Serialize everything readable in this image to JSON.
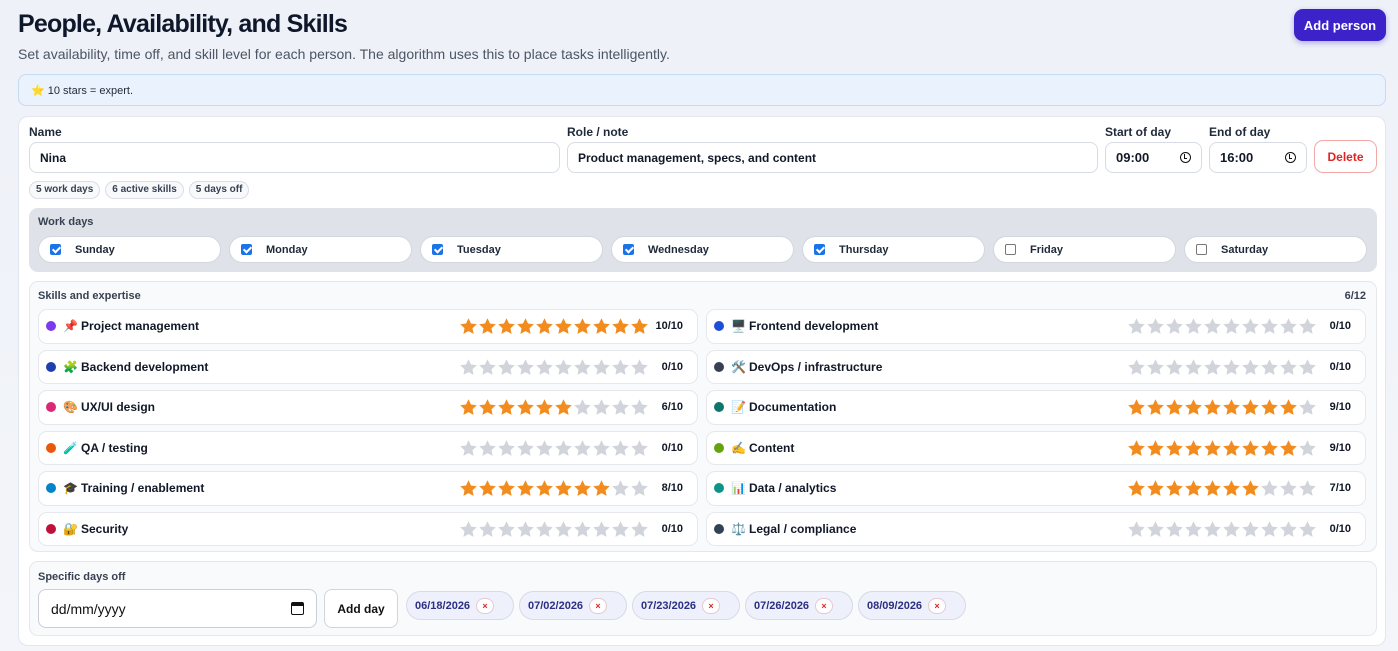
{
  "header": {
    "title": "People, Availability, and Skills",
    "subtitle": "Set availability, time off, and skill level for each person. The algorithm uses this to place tasks intelligently.",
    "add_person_label": "Add person"
  },
  "banner": {
    "text": "⭐ 10 stars = expert."
  },
  "person": {
    "name_label": "Name",
    "name_value": "Nina",
    "role_label": "Role / note",
    "role_value": "Product management, specs, and content",
    "start_label": "Start of day",
    "start_value": "09:00",
    "end_label": "End of day",
    "end_value": "16:00",
    "delete_label": "Delete",
    "chips": [
      "5 work days",
      "6 active skills",
      "5 days off"
    ]
  },
  "workdays": {
    "label": "Work days",
    "days": [
      {
        "label": "Sunday",
        "checked": true
      },
      {
        "label": "Monday",
        "checked": true
      },
      {
        "label": "Tuesday",
        "checked": true
      },
      {
        "label": "Wednesday",
        "checked": true
      },
      {
        "label": "Thursday",
        "checked": true
      },
      {
        "label": "Friday",
        "checked": false
      },
      {
        "label": "Saturday",
        "checked": false
      }
    ]
  },
  "skills": {
    "label": "Skills and expertise",
    "count": "6/12",
    "max": 10,
    "items": [
      {
        "name": "Project management",
        "emoji": "📌",
        "color": "#7c3aed",
        "rating": 10,
        "score": "10/10"
      },
      {
        "name": "Frontend development",
        "emoji": "🖥️",
        "color": "#1d4ed8",
        "rating": 0,
        "score": "0/10"
      },
      {
        "name": "Backend development",
        "emoji": "🧩",
        "color": "#1e40af",
        "rating": 0,
        "score": "0/10"
      },
      {
        "name": "DevOps / infrastructure",
        "emoji": "🛠️",
        "color": "#374151",
        "rating": 0,
        "score": "0/10"
      },
      {
        "name": "UX/UI design",
        "emoji": "🎨",
        "color": "#db2777",
        "rating": 6,
        "score": "6/10"
      },
      {
        "name": "Documentation",
        "emoji": "📝",
        "color": "#0f766e",
        "rating": 9,
        "score": "9/10"
      },
      {
        "name": "QA / testing",
        "emoji": "🧪",
        "color": "#ea580c",
        "rating": 0,
        "score": "0/10"
      },
      {
        "name": "Content",
        "emoji": "✍️",
        "color": "#65a30d",
        "rating": 9,
        "score": "9/10"
      },
      {
        "name": "Training / enablement",
        "emoji": "🎓",
        "color": "#0284c7",
        "rating": 8,
        "score": "8/10"
      },
      {
        "name": "Data / analytics",
        "emoji": "📊",
        "color": "#0d9488",
        "rating": 7,
        "score": "7/10"
      },
      {
        "name": "Security",
        "emoji": "🔐",
        "color": "#be123c",
        "rating": 0,
        "score": "0/10"
      },
      {
        "name": "Legal / compliance",
        "emoji": "⚖️",
        "color": "#334155",
        "rating": 0,
        "score": "0/10"
      }
    ]
  },
  "days_off": {
    "label": "Specific days off",
    "date_placeholder": "dd/mm/yyyy",
    "add_label": "Add day",
    "dates": [
      "06/18/2026",
      "07/02/2026",
      "07/23/2026",
      "07/26/2026",
      "08/09/2026"
    ],
    "remove_glyph": "×"
  }
}
